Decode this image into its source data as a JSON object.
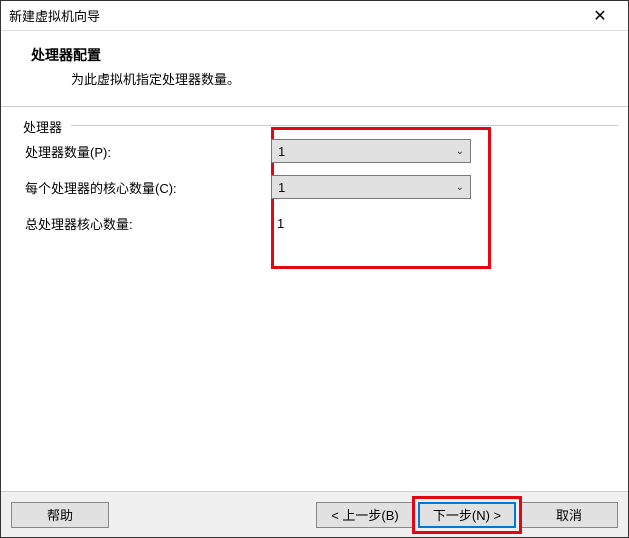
{
  "window": {
    "title": "新建虚拟机向导",
    "close_icon": "✕"
  },
  "header": {
    "title": "处理器配置",
    "subtitle": "为此虚拟机指定处理器数量。"
  },
  "fieldset": {
    "legend": "处理器"
  },
  "form": {
    "processor_count": {
      "label": "处理器数量(P):",
      "value": "1"
    },
    "cores_per_processor": {
      "label": "每个处理器的核心数量(C):",
      "value": "1"
    },
    "total_cores": {
      "label": "总处理器核心数量:",
      "value": "1"
    }
  },
  "footer": {
    "help": "帮助",
    "back": "< 上一步(B)",
    "next": "下一步(N) >",
    "cancel": "取消"
  }
}
